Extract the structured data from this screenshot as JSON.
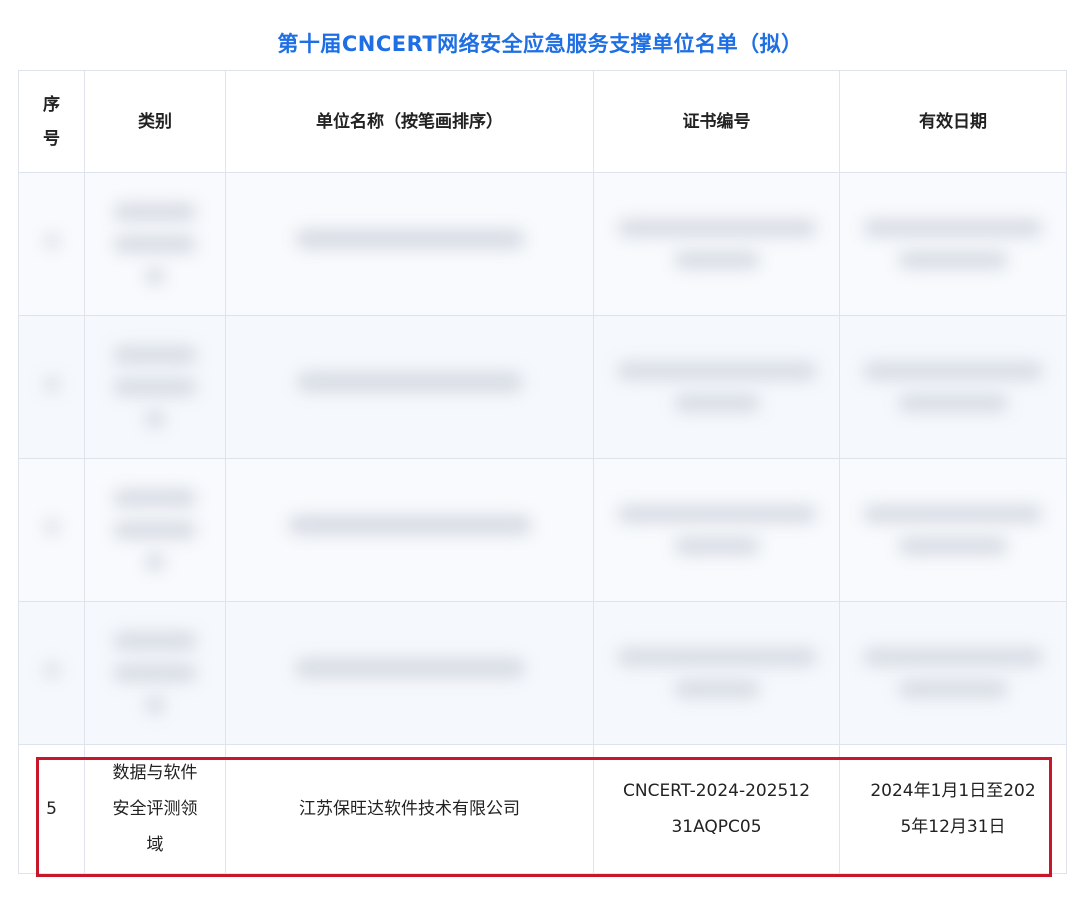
{
  "title": "第十届CNCERT网络安全应急服务支撑单位名单（拟）",
  "headers": {
    "seq_line1": "序",
    "seq_line2": "号",
    "category": "类别",
    "unit_name": "单位名称（按笔画排序）",
    "cert_no": "证书编号",
    "valid_date": "有效日期"
  },
  "visible_row": {
    "seq": "5",
    "category_line1": "数据与软件",
    "category_line2": "安全评测领",
    "category_line3": "域",
    "unit_name": "江苏保旺达软件技术有限公司",
    "cert_no_line1": "CNCERT-2024-202512",
    "cert_no_line2": "31AQPC05",
    "valid_date_line1": "2024年1月1日至202",
    "valid_date_line2": "5年12月31日"
  },
  "colors": {
    "title": "#1e6fe3",
    "highlight_border": "#c6182a",
    "grid": "#dfe4ec"
  }
}
